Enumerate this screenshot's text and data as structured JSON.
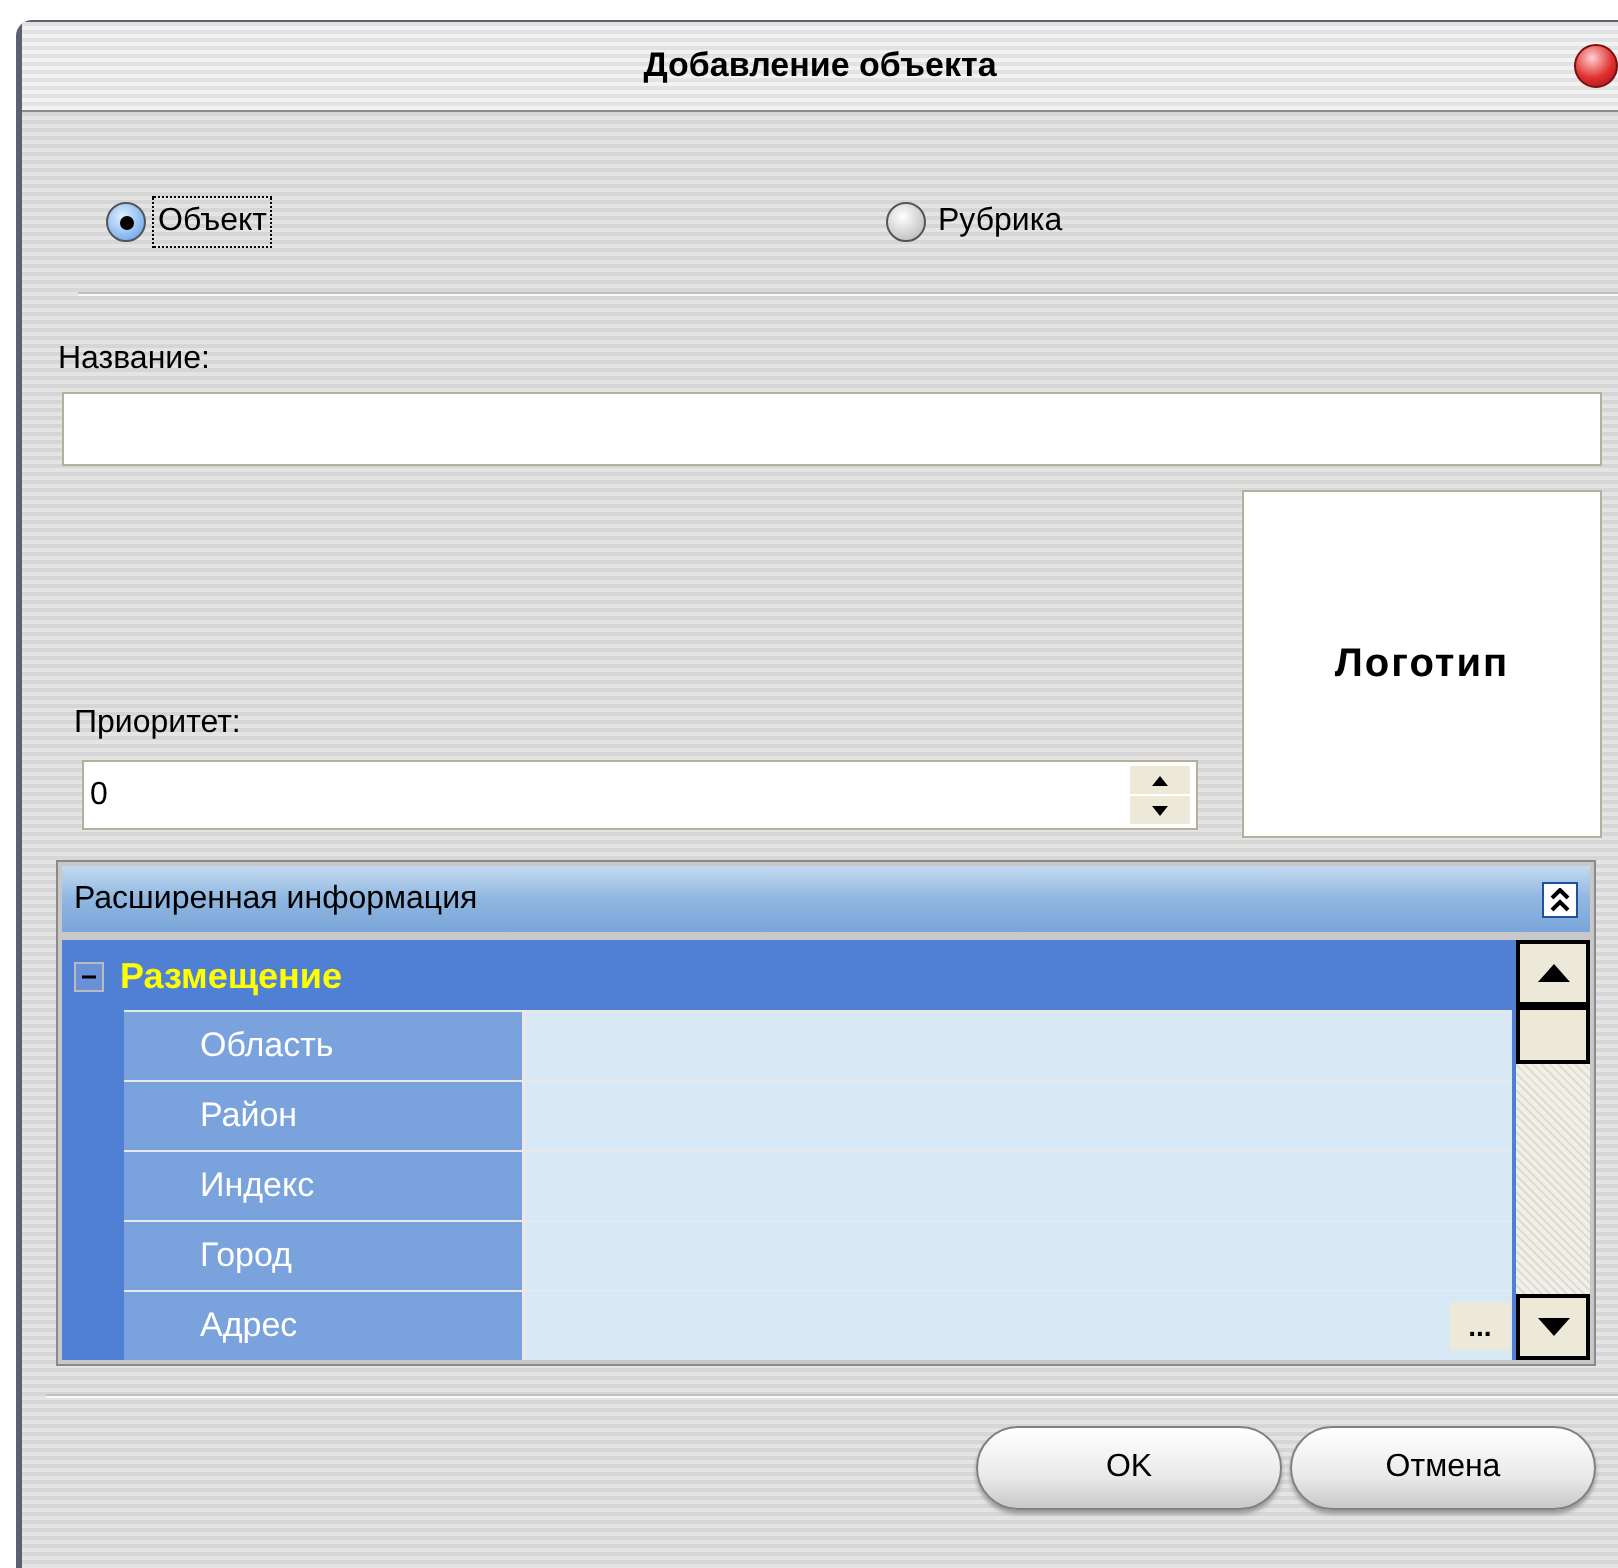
{
  "window": {
    "title": "Добавление объекта"
  },
  "mode_options": [
    {
      "label": "Объект",
      "selected": true
    },
    {
      "label": "Рубрика",
      "selected": false
    }
  ],
  "name_field": {
    "label": "Название:"
  },
  "priority_field": {
    "label": "Приоритет:",
    "value": "0"
  },
  "logo": {
    "label": "Логотип"
  },
  "extended_panel": {
    "title": "Расширенная информация",
    "expanded": true,
    "groups": [
      {
        "title": "Размещение",
        "expanded": true,
        "rows": [
          {
            "label": "Область",
            "kind": "text"
          },
          {
            "label": "Район",
            "kind": "text"
          },
          {
            "label": "Индекс",
            "kind": "text"
          },
          {
            "label": "Город",
            "kind": "text"
          },
          {
            "label": "Адрес",
            "kind": "picker",
            "button_label": "..."
          }
        ]
      }
    ]
  },
  "buttons": [
    {
      "label": "OK"
    },
    {
      "label": "Отмена"
    }
  ]
}
